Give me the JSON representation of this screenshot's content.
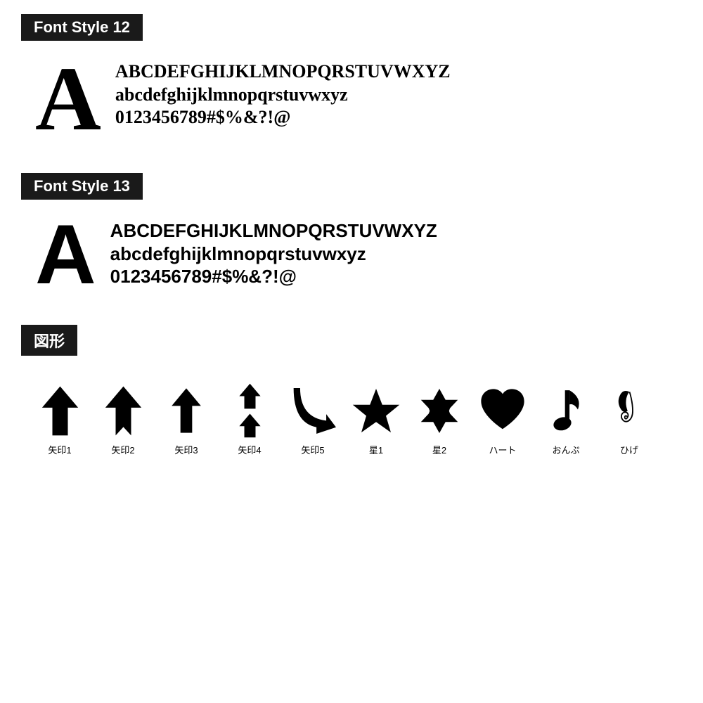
{
  "font12": {
    "label": "Font Style 12",
    "big_letter": "A",
    "line1": "ABCDEFGHIJKLMNOPQRSTUVWXYZ",
    "line2": "abcdefghijklmnopqrstuvwxyz",
    "line3": "0123456789#$%&?!@"
  },
  "font13": {
    "label": "Font Style 13",
    "big_letter": "A",
    "line1": "ABCDEFGHIJKLMNOPQRSTUVWXYZ",
    "line2": "abcdefghijklmnopqrstuvwxyz",
    "line3": "0123456789#$%&?!@"
  },
  "shapes": {
    "label": "図形",
    "items": [
      {
        "name": "矢印1",
        "id": "arrow1"
      },
      {
        "name": "矢印2",
        "id": "arrow2"
      },
      {
        "name": "矢印3",
        "id": "arrow3"
      },
      {
        "name": "矢印4",
        "id": "arrow4"
      },
      {
        "name": "矢印5",
        "id": "arrow5"
      },
      {
        "name": "星1",
        "id": "star1"
      },
      {
        "name": "星2",
        "id": "star2"
      },
      {
        "name": "ハート",
        "id": "heart"
      },
      {
        "name": "おんぷ",
        "id": "music"
      },
      {
        "name": "ひげ",
        "id": "mustache"
      }
    ]
  }
}
